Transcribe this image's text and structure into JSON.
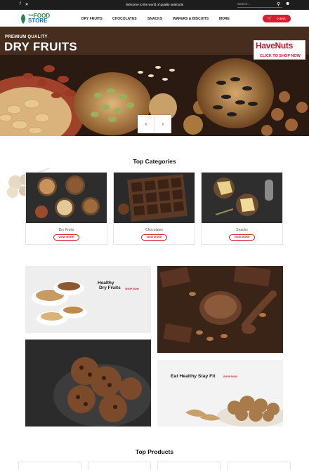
{
  "topbar": {
    "welcome": "Welcome to the world of quality seafoods",
    "search_placeholder": "Search...",
    "social": [
      "f",
      "✕"
    ]
  },
  "logo": {
    "the": "THE",
    "food": "FOOD",
    "store": "STORE"
  },
  "nav": {
    "items": [
      "DRY FRUITS",
      "CHOCOLATES",
      "SNACKS",
      "WAFERS & BISCUITS",
      "MORE"
    ],
    "cart_label": "0 Item"
  },
  "hero": {
    "eyebrow": "PREMIUM QUALITY",
    "headline": "DRY FRUITS",
    "brand_name": "HaveNuts",
    "brand_cta": "CLICK TO SHOP NOW",
    "prev": "‹",
    "next": "›"
  },
  "categories": {
    "title": "Top Categories",
    "items": [
      {
        "name": "Dry Fruits",
        "button": "VIEW MORE"
      },
      {
        "name": "Chocolates",
        "button": "VIEW MORE"
      },
      {
        "name": "Snacks",
        "button": "VIEW MORE"
      }
    ]
  },
  "banners": {
    "healthy_line1": "Healthy",
    "healthy_line2": "Dry Fruits",
    "shop_now": "SHOP NOW",
    "fit_text": "Eat Healthy Stay Fit",
    "fit_shop": "SHOP NOW"
  },
  "products": {
    "title": "Top Products"
  },
  "colors": {
    "accent": "#d71f2b",
    "green": "#2a8a3a",
    "blue": "#1f6fa8"
  }
}
